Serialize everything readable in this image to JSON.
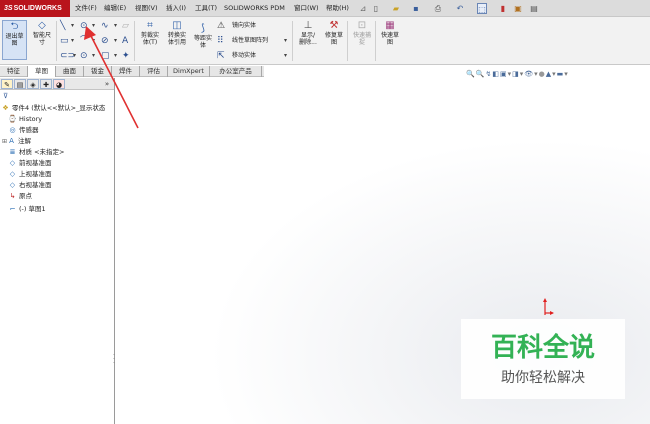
{
  "app": {
    "logo_ds": "3S",
    "logo_text": "SOLIDWORKS"
  },
  "menu": [
    {
      "name": "menu-file",
      "label": "文件(F)"
    },
    {
      "name": "menu-edit",
      "label": "编辑(E)"
    },
    {
      "name": "menu-view",
      "label": "视图(V)"
    },
    {
      "name": "menu-insert",
      "label": "插入(I)"
    },
    {
      "name": "menu-tools",
      "label": "工具(T)"
    },
    {
      "name": "menu-pdm",
      "label": "SOLIDWORKS PDM"
    },
    {
      "name": "menu-window",
      "label": "窗口(W)"
    },
    {
      "name": "menu-help",
      "label": "帮助(H)"
    }
  ],
  "commands": {
    "exit_sketch_line1": "退出草",
    "exit_sketch_line2": "图",
    "smart_dim_line1": "智能尺",
    "smart_dim_line2": "寸",
    "trim_line1": "剪裁实",
    "trim_line2": "体(T)",
    "convert_line1": "转换实",
    "convert_line2": "体引用",
    "offset_line1": "等距实",
    "offset_line2": "体",
    "mirror": "镜向实体",
    "linear_pattern": "线性草图阵列",
    "move": "移动实体",
    "show_delete_line1": "显示/",
    "show_delete_line2": "删除...",
    "repair_line1": "修复草",
    "repair_line2": "图",
    "quick_snap_line1": "快速捕",
    "quick_snap_line2": "捉",
    "rapid_sketch_line1": "快速草",
    "rapid_sketch_line2": "图"
  },
  "tabs": [
    {
      "name": "tab-features",
      "label": "特征"
    },
    {
      "name": "tab-sketch",
      "label": "草图"
    },
    {
      "name": "tab-surfaces",
      "label": "曲面"
    },
    {
      "name": "tab-sheet-metal",
      "label": "钣金"
    },
    {
      "name": "tab-weldments",
      "label": "焊件"
    },
    {
      "name": "tab-evaluate",
      "label": "评估"
    },
    {
      "name": "tab-dimxpert",
      "label": "DimXpert"
    },
    {
      "name": "tab-office",
      "label": "办公室产品"
    }
  ],
  "tree": {
    "root": "零件4 (默认<<默认>_显示状态",
    "items": [
      {
        "name": "tree-history",
        "icon": "history-icon",
        "glyph": "⌚",
        "label": "History"
      },
      {
        "name": "tree-sensors",
        "icon": "sensor-icon",
        "glyph": "◎",
        "label": "传感器"
      },
      {
        "name": "tree-annotations",
        "icon": "annotation-icon",
        "glyph": "A",
        "label": "注解"
      },
      {
        "name": "tree-material",
        "icon": "material-icon",
        "glyph": "≣",
        "label": "材质 <未指定>"
      },
      {
        "name": "tree-front-plane",
        "icon": "plane-icon",
        "glyph": "◇",
        "label": "前视基准面"
      },
      {
        "name": "tree-top-plane",
        "icon": "plane-icon",
        "glyph": "◇",
        "label": "上视基准面"
      },
      {
        "name": "tree-right-plane",
        "icon": "plane-icon",
        "glyph": "◇",
        "label": "右视基准面"
      },
      {
        "name": "tree-origin",
        "icon": "origin-icon",
        "glyph": "↳",
        "label": "原点"
      },
      {
        "name": "tree-sketch1",
        "icon": "sketch-icon",
        "glyph": "⌐",
        "label": "(-) 草图1"
      }
    ]
  },
  "watermark": {
    "title": "百科全说",
    "subtitle": "助你轻松解决"
  },
  "colors": {
    "brand_red": "#b9141b",
    "arrow_red": "#e03030",
    "watermark_green": "#33b255"
  }
}
